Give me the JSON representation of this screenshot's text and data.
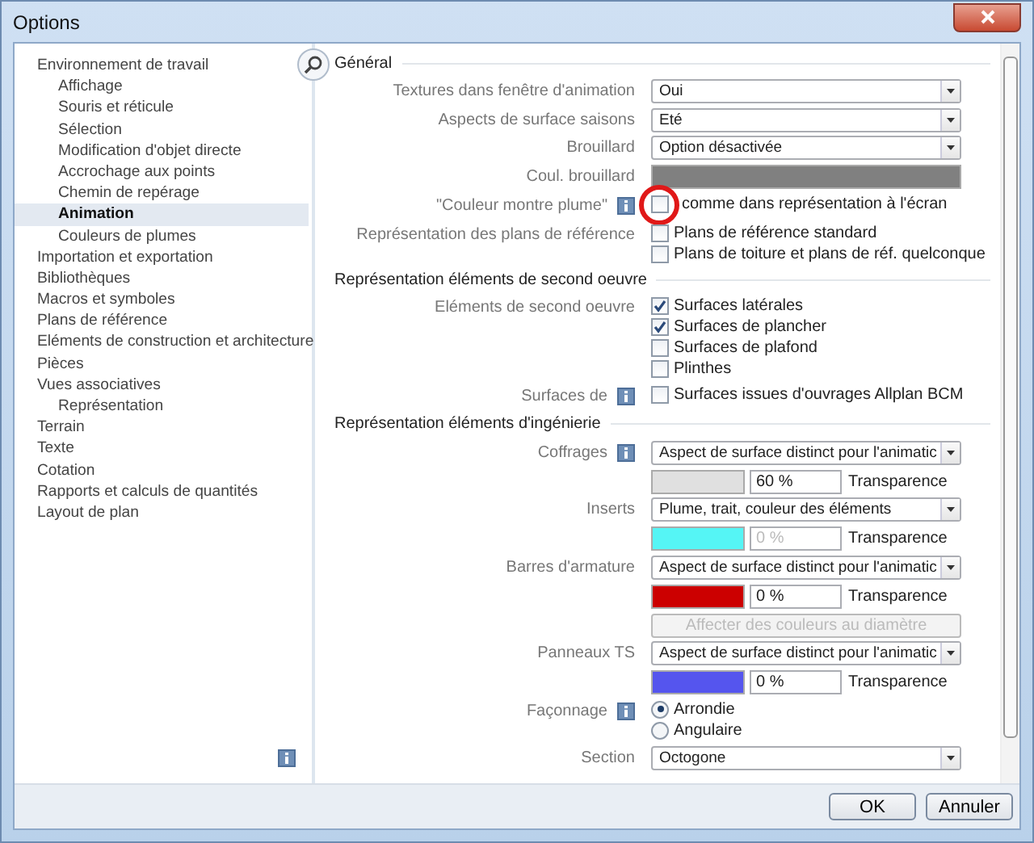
{
  "window": {
    "title": "Options"
  },
  "sidebar": {
    "items": [
      {
        "label": "Environnement de travail",
        "selected": false,
        "children": [
          {
            "label": "Affichage",
            "selected": false
          },
          {
            "label": "Souris et réticule",
            "selected": false
          },
          {
            "label": "Sélection",
            "selected": false
          },
          {
            "label": "Modification d'objet directe",
            "selected": false
          },
          {
            "label": "Accrochage aux points",
            "selected": false
          },
          {
            "label": "Chemin de repérage",
            "selected": false
          },
          {
            "label": "Animation",
            "selected": true
          },
          {
            "label": "Couleurs de plumes",
            "selected": false
          }
        ]
      },
      {
        "label": "Importation et exportation",
        "selected": false
      },
      {
        "label": "Bibliothèques",
        "selected": false
      },
      {
        "label": "Macros et symboles",
        "selected": false
      },
      {
        "label": "Plans de référence",
        "selected": false
      },
      {
        "label": "Eléments de construction et architecture",
        "selected": false
      },
      {
        "label": "Pièces",
        "selected": false
      },
      {
        "label": "Vues associatives",
        "selected": false,
        "children": [
          {
            "label": "Représentation",
            "selected": false
          }
        ]
      },
      {
        "label": "Terrain",
        "selected": false
      },
      {
        "label": "Texte",
        "selected": false
      },
      {
        "label": "Cotation",
        "selected": false
      },
      {
        "label": "Rapports et calculs de quantités",
        "selected": false
      },
      {
        "label": "Layout de plan",
        "selected": false
      }
    ]
  },
  "panel": {
    "sections": [
      {
        "title": "Général",
        "rows": [
          {
            "label": "Textures dans fenêtre d'animation",
            "info": false,
            "kind": "select",
            "value": "Oui"
          },
          {
            "label": "Aspects de surface saisons",
            "info": false,
            "kind": "select",
            "value": "Eté"
          },
          {
            "label": "Brouillard",
            "info": false,
            "kind": "select",
            "value": "Option désactivée"
          },
          {
            "label": "Coul. brouillard",
            "info": false,
            "kind": "color",
            "color": "#808080"
          },
          {
            "label": "\"Couleur montre plume\"",
            "info": true,
            "kind": "checks",
            "options": [
              {
                "label": "comme dans représentation à l'écran",
                "checked": false
              }
            ]
          },
          {
            "label": "Représentation des plans de référence",
            "info": false,
            "kind": "checks",
            "options": [
              {
                "label": "Plans de référence standard",
                "checked": false
              },
              {
                "label": "Plans de toiture et plans de réf. quelconque",
                "checked": false
              }
            ]
          }
        ]
      },
      {
        "title": "Représentation éléments de second oeuvre",
        "rows": [
          {
            "label": "Eléments de second oeuvre",
            "info": false,
            "kind": "checks",
            "options": [
              {
                "label": "Surfaces latérales",
                "checked": true
              },
              {
                "label": "Surfaces de plancher",
                "checked": true
              },
              {
                "label": "Surfaces de plafond",
                "checked": false
              },
              {
                "label": "Plinthes",
                "checked": false
              }
            ]
          },
          {
            "label": "Surfaces de",
            "info": true,
            "kind": "checks",
            "options": [
              {
                "label": "Surfaces issues d'ouvrages Allplan BCM",
                "checked": false
              }
            ]
          }
        ]
      },
      {
        "title": "Représentation éléments d'ingénierie",
        "rows": [
          {
            "label": "Coffrages",
            "info": true,
            "kind": "select",
            "value": "Aspect de surface distinct pour l'animatic"
          },
          {
            "kind": "transparency",
            "color": "#e0e0e0",
            "value": "60 %",
            "caption": "Transparence",
            "disabled": false
          },
          {
            "label": "Inserts",
            "info": false,
            "kind": "select",
            "value": "Plume, trait, couleur des éléments"
          },
          {
            "kind": "transparency",
            "color": "#55f5f5",
            "value": "0 %",
            "caption": "Transparence",
            "disabled": true
          },
          {
            "label": "Barres d'armature",
            "info": false,
            "kind": "select",
            "value": "Aspect de surface distinct pour l'animatic"
          },
          {
            "kind": "transparency",
            "color": "#cc0000",
            "value": "0 %",
            "caption": "Transparence",
            "disabled": false
          },
          {
            "kind": "button",
            "text": "Affecter des couleurs au diamètre",
            "disabled": true
          },
          {
            "label": "Panneaux TS",
            "info": false,
            "kind": "select",
            "value": "Aspect de surface distinct pour l'animatic"
          },
          {
            "kind": "transparency",
            "color": "#5555ee",
            "value": "0 %",
            "caption": "Transparence",
            "disabled": false
          },
          {
            "label": "Façonnage",
            "info": true,
            "kind": "radio",
            "options": [
              {
                "label": "Arrondie",
                "selected": true
              },
              {
                "label": "Angulaire",
                "selected": false
              }
            ]
          },
          {
            "label": "Section",
            "info": false,
            "kind": "select",
            "value": "Octogone"
          }
        ]
      }
    ]
  },
  "buttons": [
    "OK",
    "Annuler"
  ]
}
